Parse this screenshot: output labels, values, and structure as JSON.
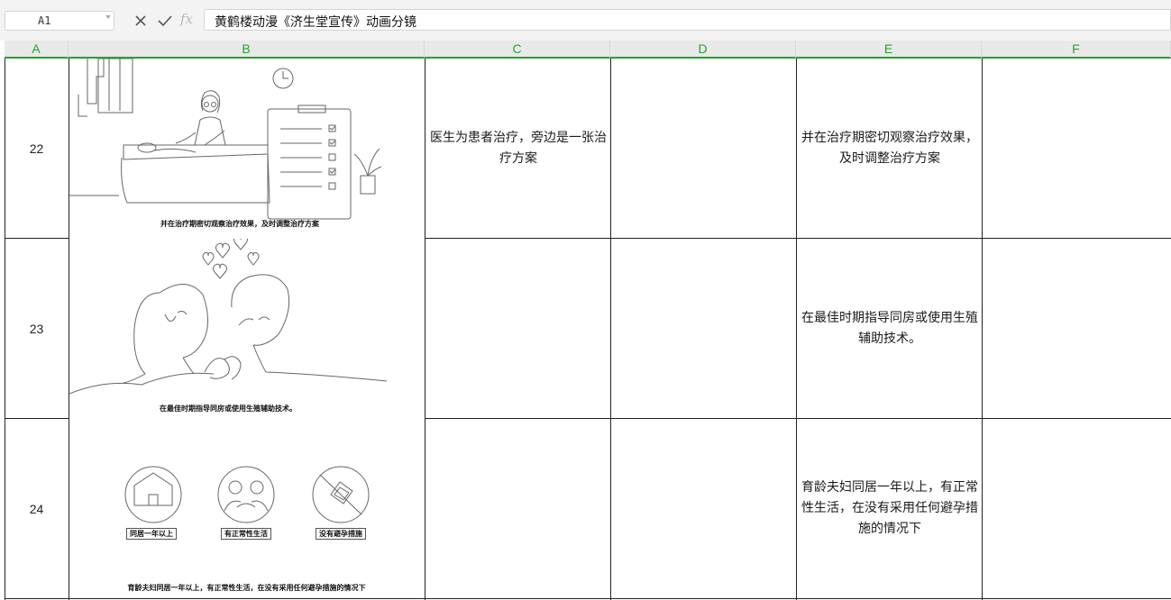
{
  "formula_bar": {
    "name_box": "A1",
    "fx_icon": "fx",
    "cancel_icon": "close-icon",
    "accept_icon": "check-icon",
    "content": "黄鹤楼动漫《济生堂宣传》动画分镜"
  },
  "columns": [
    "A",
    "B",
    "C",
    "D",
    "E",
    "F"
  ],
  "rows": [
    {
      "number": "22",
      "image_caption": "并在治疗期密切观察治疗效果，及时调整治疗方案",
      "c": "医生为患者治疗，旁边是一张治疗方案",
      "d": "",
      "e": "并在治疗期密切观察治疗效果，及时调整治疗方案",
      "f": ""
    },
    {
      "number": "23",
      "image_caption": "在最佳时期指导同房或使用生殖辅助技术。",
      "c": "",
      "d": "",
      "e": "在最佳时期指导同房或使用生殖辅助技术。",
      "f": ""
    },
    {
      "number": "24",
      "image_caption": "育龄夫妇同居一年以上，有正常性生活，在没有采用任何避孕措施的情况下",
      "icon_labels": [
        "同居一年以上",
        "有正常性生活",
        "没有避孕措施"
      ],
      "c": "",
      "d": "",
      "e": "育龄夫妇同居一年以上，有正常性生活，在没有采用任何避孕措施的情况下",
      "f": ""
    }
  ],
  "colors": {
    "accent": "#21a32b",
    "grid": "#222222",
    "toolbar": "#f3f3f3"
  }
}
